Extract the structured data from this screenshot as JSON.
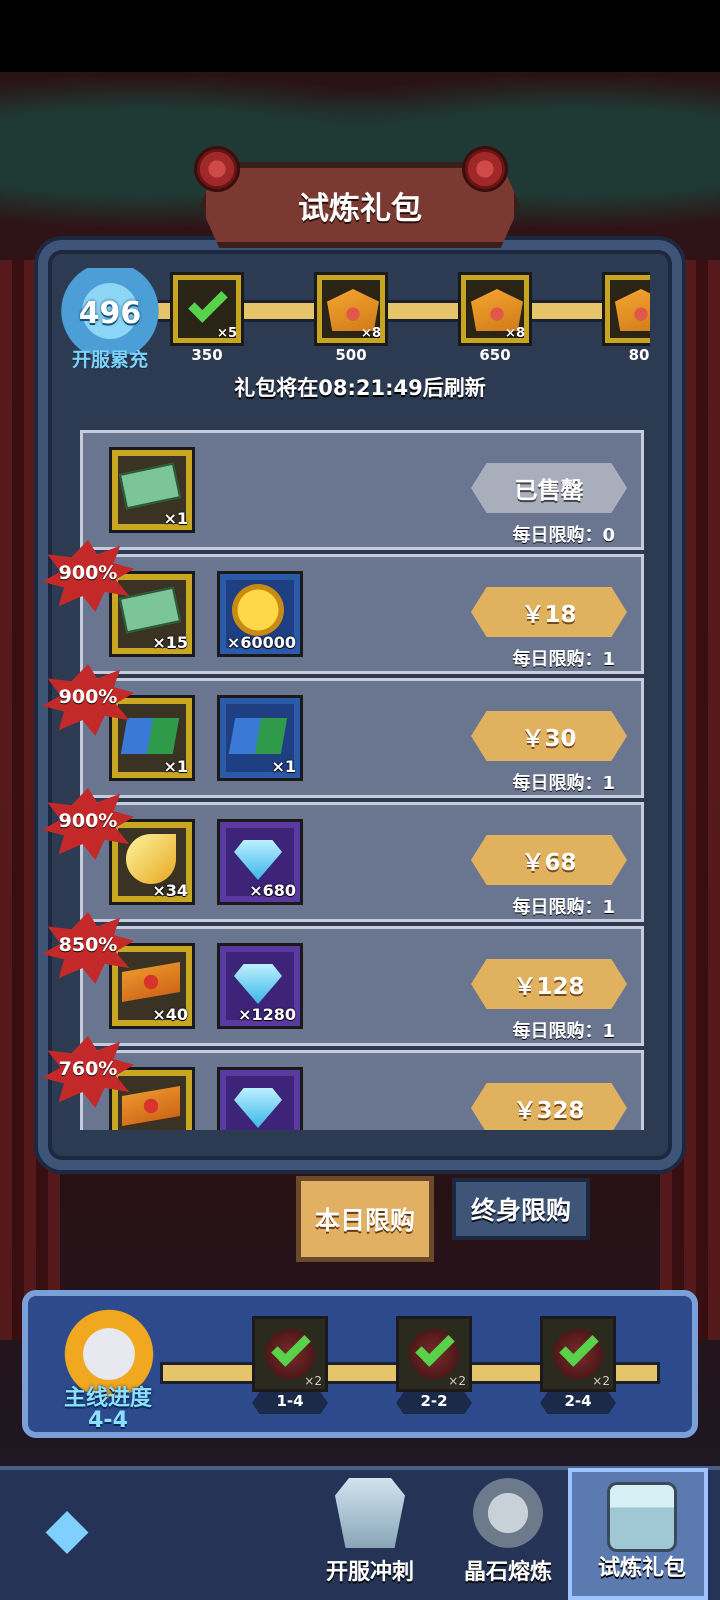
{
  "header": {
    "title": "试炼礼包"
  },
  "cumulative": {
    "value": "496",
    "label": "开服累充"
  },
  "milestones": [
    {
      "threshold": "350",
      "count": "×5",
      "claimed": true
    },
    {
      "threshold": "500",
      "count": "×8",
      "claimed": false
    },
    {
      "threshold": "650",
      "count": "×8",
      "claimed": false
    },
    {
      "threshold": "80",
      "count": "",
      "claimed": false
    }
  ],
  "refresh_text": "礼包将在08:21:49后刷新",
  "packs": [
    {
      "bonus": "",
      "items": [
        {
          "icon": "ticket-icon",
          "qty": "×1",
          "frame": "yellow"
        }
      ],
      "price": "已售罄",
      "sold_out": true,
      "limit": "每日限购：0"
    },
    {
      "bonus": "900%",
      "items": [
        {
          "icon": "ticket-icon",
          "qty": "×15",
          "frame": "yellow"
        },
        {
          "icon": "gold-coin-icon",
          "qty": "×60000",
          "frame": "blue"
        }
      ],
      "price": "￥18",
      "limit": "每日限购：1"
    },
    {
      "bonus": "900%",
      "items": [
        {
          "icon": "book-icon",
          "qty": "×1",
          "frame": "yellow"
        },
        {
          "icon": "book-icon",
          "qty": "×1",
          "frame": "blue"
        }
      ],
      "price": "￥30",
      "limit": "每日限购：1"
    },
    {
      "bonus": "900%",
      "items": [
        {
          "icon": "claw-icon",
          "qty": "×34",
          "frame": "yellow"
        },
        {
          "icon": "diamond-icon",
          "qty": "×680",
          "frame": "purple"
        }
      ],
      "price": "￥68",
      "limit": "每日限购：1"
    },
    {
      "bonus": "850%",
      "items": [
        {
          "icon": "rose-ticket-icon",
          "qty": "×40",
          "frame": "yellow"
        },
        {
          "icon": "diamond-icon",
          "qty": "×1280",
          "frame": "purple"
        }
      ],
      "price": "￥128",
      "limit": "每日限购：1"
    },
    {
      "bonus": "760%",
      "items": [
        {
          "icon": "rose-ticket-icon",
          "qty": "",
          "frame": "yellow"
        },
        {
          "icon": "diamond-icon",
          "qty": "",
          "frame": "purple"
        }
      ],
      "price": "￥328",
      "limit": ""
    }
  ],
  "tabs": {
    "daily": "本日限购",
    "lifetime": "终身限购"
  },
  "main_progress": {
    "label": "主线进度",
    "stage": "4-4",
    "nodes": [
      {
        "stage": "1-4",
        "count": "×2"
      },
      {
        "stage": "2-2",
        "count": "×2"
      },
      {
        "stage": "2-4",
        "count": "×2"
      }
    ]
  },
  "nav": {
    "back_icon": "back-icon",
    "items": [
      {
        "label": "开服冲刺"
      },
      {
        "label": "晶石熔炼"
      },
      {
        "label": "试炼礼包"
      }
    ]
  },
  "colors": {
    "gold": "#e0b15e",
    "frame": "#3e5578",
    "panel": "#2d4a8c",
    "bonus_red": "#c4292a"
  }
}
